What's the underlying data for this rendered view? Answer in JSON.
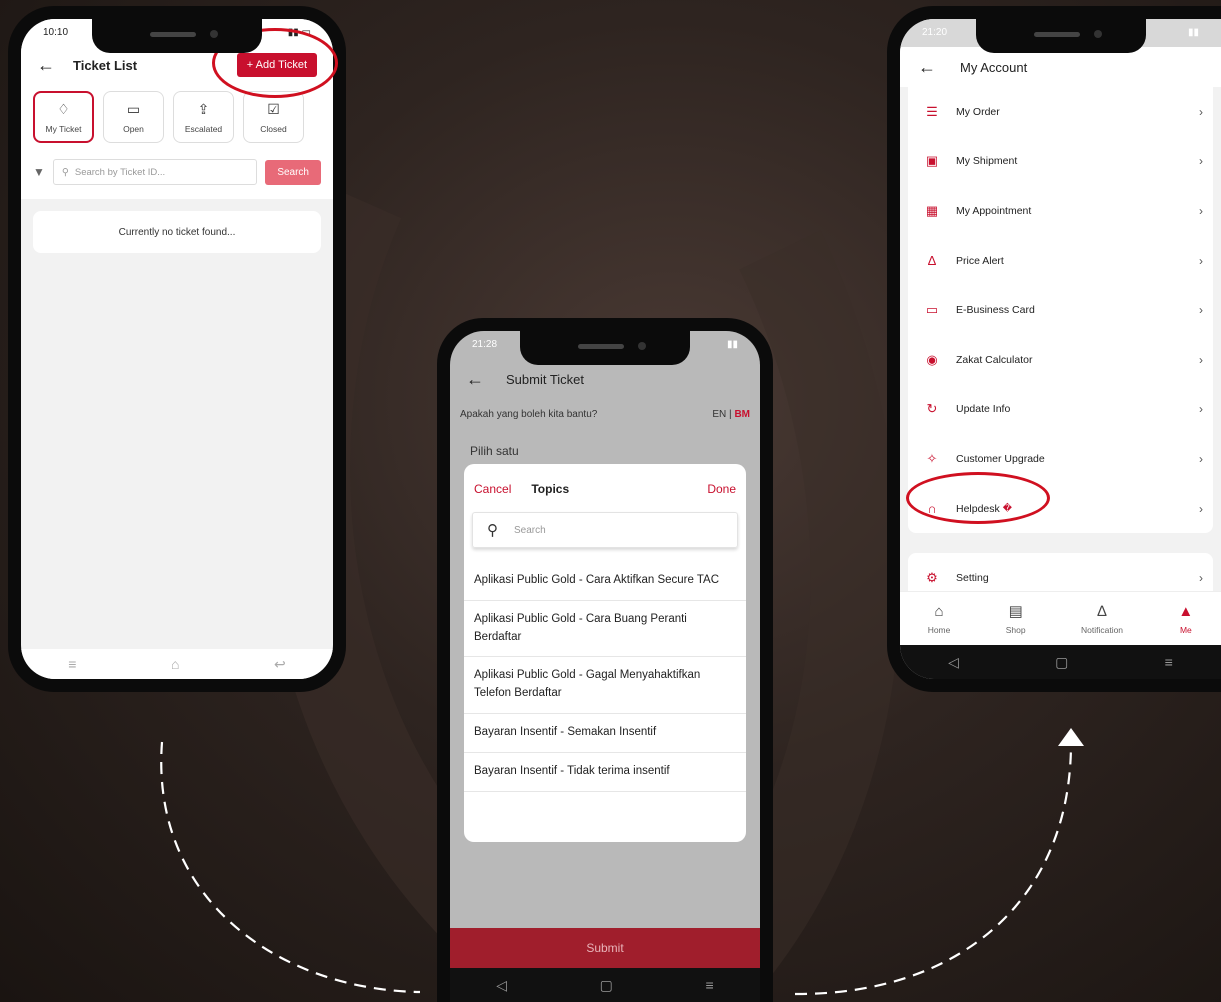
{
  "colors": {
    "accent": "#c8102e",
    "highlight": "#d01020",
    "background": "#2e2420"
  },
  "phone1": {
    "status_time": "10:10",
    "title": "Ticket List",
    "back_icon": "arrow-left-icon",
    "add_label": "+ Add Ticket",
    "tabs": [
      {
        "label": "My Ticket",
        "icon": "ticket-icon",
        "glyph": "♢"
      },
      {
        "label": "Open",
        "icon": "folder-icon",
        "glyph": "▭"
      },
      {
        "label": "Escalated",
        "icon": "escalate-icon",
        "glyph": "⇪"
      },
      {
        "label": "Closed",
        "icon": "check-box-icon",
        "glyph": "☑"
      }
    ],
    "search_placeholder": "Search by Ticket ID...",
    "search_button": "Search",
    "empty_text": "Currently no ticket found..."
  },
  "phone2": {
    "status_time": "21:28",
    "title": "Submit Ticket",
    "help_text": "Apakah yang boleh kita bantu?",
    "lang_en": "EN",
    "lang_sep": "|",
    "lang_bm": "BM",
    "pilih": "Pilih satu",
    "sheet": {
      "cancel": "Cancel",
      "title": "Topics",
      "done": "Done",
      "search_placeholder": "Search"
    },
    "topics": [
      "Aplikasi Public Gold - Cara Aktifkan Secure TAC",
      "Aplikasi Public Gold - Cara Buang Peranti Berdaftar",
      "Aplikasi Public Gold - Gagal Menyahaktifkan Telefon Berdaftar",
      "Bayaran Insentif - Semakan Insentif",
      "Bayaran Insentif - Tidak terima insentif"
    ],
    "submit": "Submit"
  },
  "phone3": {
    "status_time": "21:20",
    "title": "My Account",
    "menu": [
      {
        "label": "My Order",
        "icon": "order-icon",
        "glyph": "☰"
      },
      {
        "label": "My Shipment",
        "icon": "shipment-icon",
        "glyph": "▣"
      },
      {
        "label": "My Appointment",
        "icon": "calendar-icon",
        "glyph": "▦"
      },
      {
        "label": "Price Alert",
        "icon": "bell-icon",
        "glyph": "∆"
      },
      {
        "label": "E-Business Card",
        "icon": "card-icon",
        "glyph": "▭"
      },
      {
        "label": "Zakat Calculator",
        "icon": "calculator-icon",
        "glyph": "◉"
      },
      {
        "label": "Update Info",
        "icon": "refresh-icon",
        "glyph": "↻"
      },
      {
        "label": "Customer Upgrade",
        "icon": "sparkle-icon",
        "glyph": "✧"
      },
      {
        "label": "Helpdesk",
        "icon": "headset-icon",
        "glyph": "∩",
        "badge": "�"
      }
    ],
    "setting": {
      "label": "Setting",
      "icon": "gear-icon",
      "glyph": "⚙"
    },
    "bottom_nav": [
      {
        "label": "Home",
        "icon": "home-icon",
        "glyph": "⌂"
      },
      {
        "label": "Shop",
        "icon": "shop-bag-icon",
        "glyph": "▤"
      },
      {
        "label": "Notification",
        "icon": "bell-icon",
        "glyph": "∆"
      },
      {
        "label": "Me",
        "icon": "person-icon",
        "glyph": "▲"
      }
    ]
  }
}
